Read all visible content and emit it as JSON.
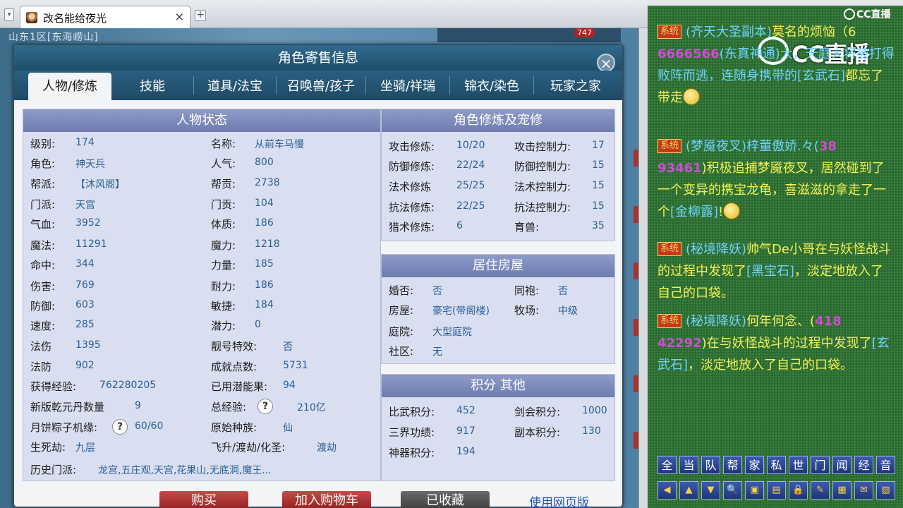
{
  "browser": {
    "tab_title": "改名能给夜光",
    "close_glyph": "×",
    "newtab_glyph": "+",
    "dropdown_glyph": "▾"
  },
  "game": {
    "server_line": "山东1区[东海崂山]",
    "badge": "747"
  },
  "dialog": {
    "title": "角色寄售信息",
    "close_glyph": "×",
    "tabs": [
      "人物/修炼",
      "技能",
      "道具/法宝",
      "召唤兽/孩子",
      "坐骑/祥瑞",
      "锦衣/染色",
      "玩家之家"
    ],
    "status_panel": {
      "title": "人物状态",
      "left": [
        {
          "label": "级别:",
          "value": "174"
        },
        {
          "label": "角色:",
          "value": "神天兵"
        },
        {
          "label": "帮派:",
          "value": "【沐风阁】"
        },
        {
          "label": "门派:",
          "value": "天宫"
        },
        {
          "label": "气血:",
          "value": "3952"
        },
        {
          "label": "魔法:",
          "value": "11291"
        },
        {
          "label": "命中:",
          "value": "344"
        },
        {
          "label": "伤害:",
          "value": "769"
        },
        {
          "label": "防御:",
          "value": "603"
        },
        {
          "label": "速度:",
          "value": "285"
        },
        {
          "label": "法伤",
          "value": "1395"
        },
        {
          "label": "法防",
          "value": "902"
        },
        {
          "label": "获得经验:",
          "value": "762280205"
        },
        {
          "label": "新版乾元丹数量",
          "value": "9"
        },
        {
          "label": "月饼粽子机缘:",
          "value": "60/60"
        },
        {
          "label": "生死劫:",
          "value": "九层"
        }
      ],
      "right": [
        {
          "label": "名称:",
          "value": "从前车马慢"
        },
        {
          "label": "人气:",
          "value": "800"
        },
        {
          "label": "帮贡:",
          "value": "2738"
        },
        {
          "label": "门贡:",
          "value": "104"
        },
        {
          "label": "体质:",
          "value": "186"
        },
        {
          "label": "魔力:",
          "value": "1218"
        },
        {
          "label": "力量:",
          "value": "185"
        },
        {
          "label": "耐力:",
          "value": "186"
        },
        {
          "label": "敏捷:",
          "value": "184"
        },
        {
          "label": "潜力:",
          "value": "0"
        },
        {
          "label": "靓号特效:",
          "value": "否"
        },
        {
          "label": "成就点数:",
          "value": "5731"
        },
        {
          "label": "已用潜能果:",
          "value": "94"
        },
        {
          "label": "总经验:",
          "value": "210亿"
        },
        {
          "label": "原始种族:",
          "value": "仙"
        },
        {
          "label": "飞升/渡劫/化圣:",
          "value": "渡劫"
        }
      ],
      "history": {
        "label": "历史门派:",
        "value": "龙宫,五庄观,天宫,花果山,无底洞,魔王..."
      },
      "help_glyph": "?"
    },
    "cultivation_panel": {
      "title": "角色修炼及宠修",
      "rows": [
        {
          "l1": "攻击修炼:",
          "v1": "10/20",
          "l2": "攻击控制力:",
          "v2": "17"
        },
        {
          "l1": "防御修炼:",
          "v1": "22/24",
          "l2": "防御控制力:",
          "v2": "15"
        },
        {
          "l1": "法术修炼",
          "v1": "25/25",
          "l2": "法术控制力:",
          "v2": "15"
        },
        {
          "l1": "抗法修炼:",
          "v1": "22/25",
          "l2": "抗法控制力:",
          "v2": "15"
        },
        {
          "l1": "猎术修炼:",
          "v1": "6",
          "l2": "育兽:",
          "v2": "35"
        }
      ]
    },
    "house_panel": {
      "title": "居住房屋",
      "rows": [
        {
          "l1": "婚否:",
          "v1": "否",
          "l2": "同袍:",
          "v2": "否"
        },
        {
          "l1": "房屋:",
          "v1": "豪宅(带阁楼)",
          "l2": "牧场:",
          "v2": "中级"
        },
        {
          "l1": "庭院:",
          "v1": "大型庭院",
          "l2": "",
          "v2": ""
        },
        {
          "l1": "社区:",
          "v1": "无",
          "l2": "",
          "v2": ""
        }
      ]
    },
    "score_panel": {
      "title": "积分 其他",
      "rows": [
        {
          "l1": "比武积分:",
          "v1": "452",
          "l2": "剑会积分:",
          "v2": "1000"
        },
        {
          "l1": "三界功绩:",
          "v1": "917",
          "l2": "副本积分:",
          "v2": "130"
        },
        {
          "l1": "神器积分:",
          "v1": "194",
          "l2": "",
          "v2": ""
        }
      ]
    },
    "buttons": {
      "buy": "购买",
      "cart": "加入购物车",
      "favorited": "已收藏",
      "web": "使用网页版"
    }
  },
  "chat": {
    "watermark_small": "CC直播",
    "watermark_big": "CC直播",
    "sys_tag": "系统",
    "messages": [
      {
        "src": "(齐天大圣副本)",
        "pre": "莫名的烦恼（6",
        "nums": "6666566",
        "mid": "(东真神通)大，天庭大将被打得败阵而逃，连随身携带的",
        "item": "[玄武石]",
        "post": "都忘了带走"
      },
      {
        "src": "(梦魇夜叉)",
        "pre": "梓董傲娇.々(",
        "nums": "38",
        "nums2": "93461",
        "mid": ")积极追捕梦魇夜叉，居然碰到了一个变异的携宝龙龟，喜滋滋的拿走了一个",
        "item": "[金柳露]",
        "post": "!"
      },
      {
        "src": "(秘境降妖)",
        "pre": "帅气De小哥在与妖怪战斗的过程中发现了",
        "item": "[黑宝石]",
        "post": "，淡定地放入了自己的口袋。"
      },
      {
        "src": "(秘境降妖)",
        "pre": "何年何念、(",
        "nums": "418",
        "nums2": "42292",
        "mid": ")在与妖怪战斗的过程中发现了",
        "item": "[玄武石]",
        "post": "，淡定地放入了自己的口袋。"
      }
    ],
    "channel_buttons": [
      "全",
      "当",
      "队",
      "帮",
      "家",
      "私",
      "世",
      "门",
      "闻",
      "经",
      "音"
    ],
    "tool_icons": [
      "◀",
      "▲",
      "▼",
      "🔍",
      "▣",
      "▤",
      "🔒",
      "✎",
      "▦",
      "✉",
      "▧"
    ]
  }
}
